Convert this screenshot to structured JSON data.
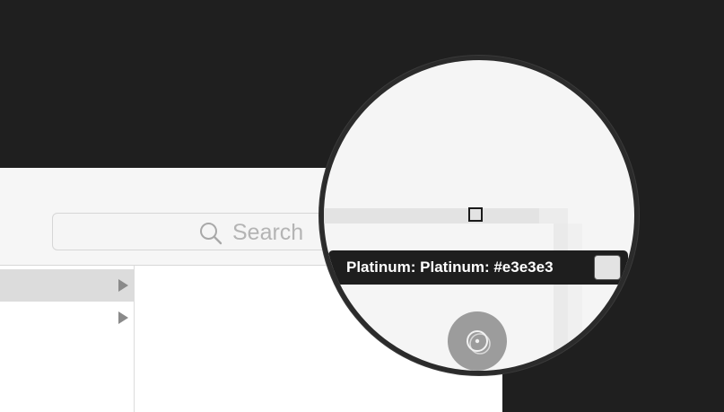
{
  "search": {
    "placeholder": "Search"
  },
  "sidebar": {
    "rows": [
      {
        "selected": true
      },
      {
        "selected": false
      }
    ]
  },
  "tooltip": {
    "text": "Platinum: Platinum: #e3e3e3",
    "swatch_color": "#e3e3e3"
  },
  "icons": {
    "search": "search-icon",
    "disc": "disc-icon",
    "disclosure": "disclosure-triangle-icon"
  }
}
